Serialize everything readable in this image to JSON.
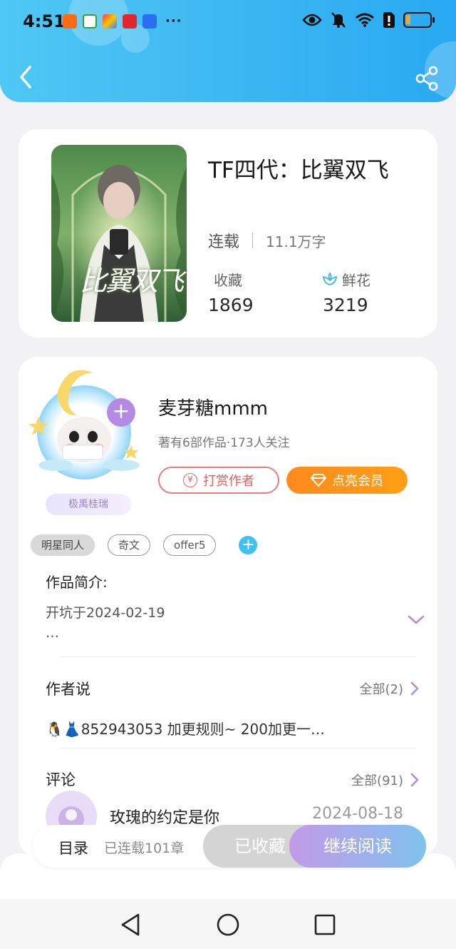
{
  "status_bar": {
    "time": "4:51",
    "notification_icons": [
      "taobao-icon",
      "app-icon",
      "app-icon",
      "huawei-icon",
      "app-icon"
    ],
    "more": "···",
    "battery_level": 0.2
  },
  "book": {
    "title": "TF四代：比翼双飞",
    "status": "连载",
    "word_count": "11.1万字",
    "favorites_label": "收藏",
    "favorites_count": "1869",
    "flowers_label": "鲜花",
    "flowers_count": "3219",
    "cover_text": "比翼双飞"
  },
  "author": {
    "name": "麦芽糖mmm",
    "meta": "著有6部作品·173人关注",
    "badge": "极禹桂瑞",
    "tip_button": "打赏作者",
    "tip_symbol": "¥",
    "vip_button": "点亮会员"
  },
  "tags": [
    "明星同人",
    "奇文",
    "offer5"
  ],
  "intro": {
    "title": "作品简介:",
    "line1": "开坑于2024-02-19",
    "line2": "…"
  },
  "author_notes": {
    "title": "作者说",
    "more": "全部(2)",
    "text": "🐧👗852943053 加更规则~ 200加更一…"
  },
  "comments": {
    "title": "评论",
    "more": "全部(91)",
    "first_user": "玫瑰的约定是你",
    "first_date": "2024-08-18"
  },
  "action_bar": {
    "toc": "目录",
    "toc_status": "已连载101章",
    "collected": "已收藏",
    "continue": "继续阅读"
  },
  "colors": {
    "header": "#3cb6f2",
    "accent_orange": "#ff9418",
    "tip_red": "#e05f5f",
    "tag_add": "#3fc1f1",
    "purple": "#b48be4"
  }
}
